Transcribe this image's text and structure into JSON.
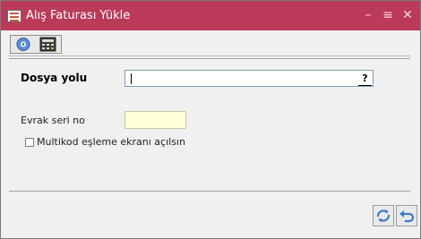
{
  "window": {
    "title": "Alış Faturası Yükle",
    "controls": {
      "minimize": "–",
      "maximize": "≡",
      "close": "✕"
    }
  },
  "toolbar": {
    "buttons": [
      {
        "icon": "settings-disc-icon"
      },
      {
        "icon": "calculator-icon"
      }
    ]
  },
  "form": {
    "file_path_label": "Dosya yolu",
    "file_path_value": "",
    "browse_label": "?",
    "serial_label": "Evrak seri no",
    "serial_value": "",
    "multikod_label": "Multikod eşleme ekranı açılsın",
    "multikod_checked": false
  },
  "footer": {
    "buttons": [
      {
        "icon": "apply-icon"
      },
      {
        "icon": "undo-icon"
      }
    ]
  },
  "colors": {
    "titlebar": "#bb3a5a",
    "serial_field_bg": "#ffffd9",
    "accent_blue": "#3a79c9"
  }
}
